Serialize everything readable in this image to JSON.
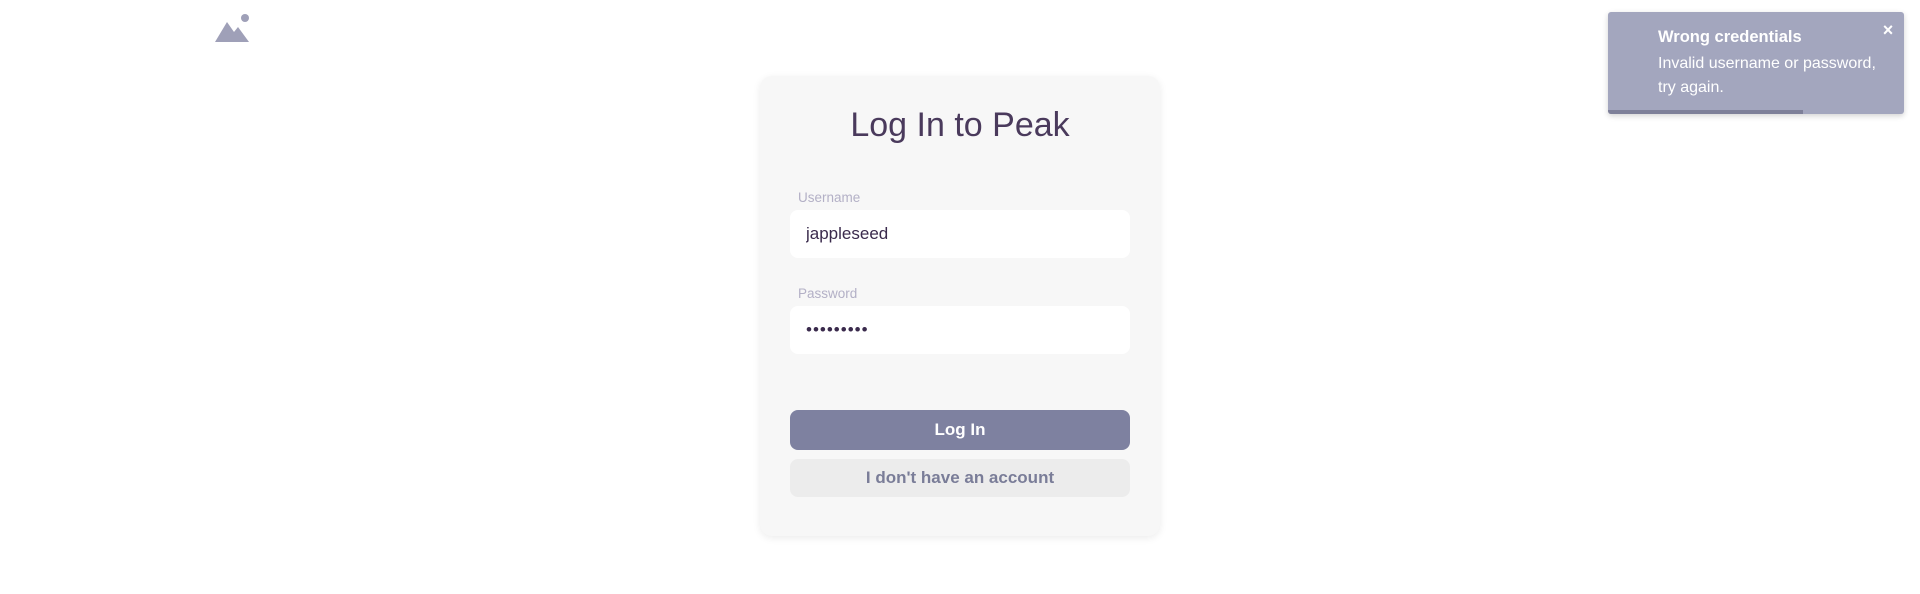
{
  "brand": {
    "logo_icon": "mountain-sun-icon",
    "logo_color": "#9fa0b8"
  },
  "login_card": {
    "title": "Log In to Peak",
    "username": {
      "label": "Username",
      "value": "jappleseed"
    },
    "password": {
      "label": "Password",
      "value": "•••••••••"
    },
    "login_button_label": "Log In",
    "no_account_button_label": "I don't have an account"
  },
  "toast": {
    "title": "Wrong credentials",
    "message": "Invalid username or password, try again.",
    "close_icon": "close-icon",
    "close_glyph": "×",
    "progress_fraction": 0.66,
    "background_color": "#a3a6be"
  },
  "colors": {
    "accent": "#7e81a0",
    "title_text": "#4a3a5c",
    "label_text": "#b3b0c6"
  }
}
